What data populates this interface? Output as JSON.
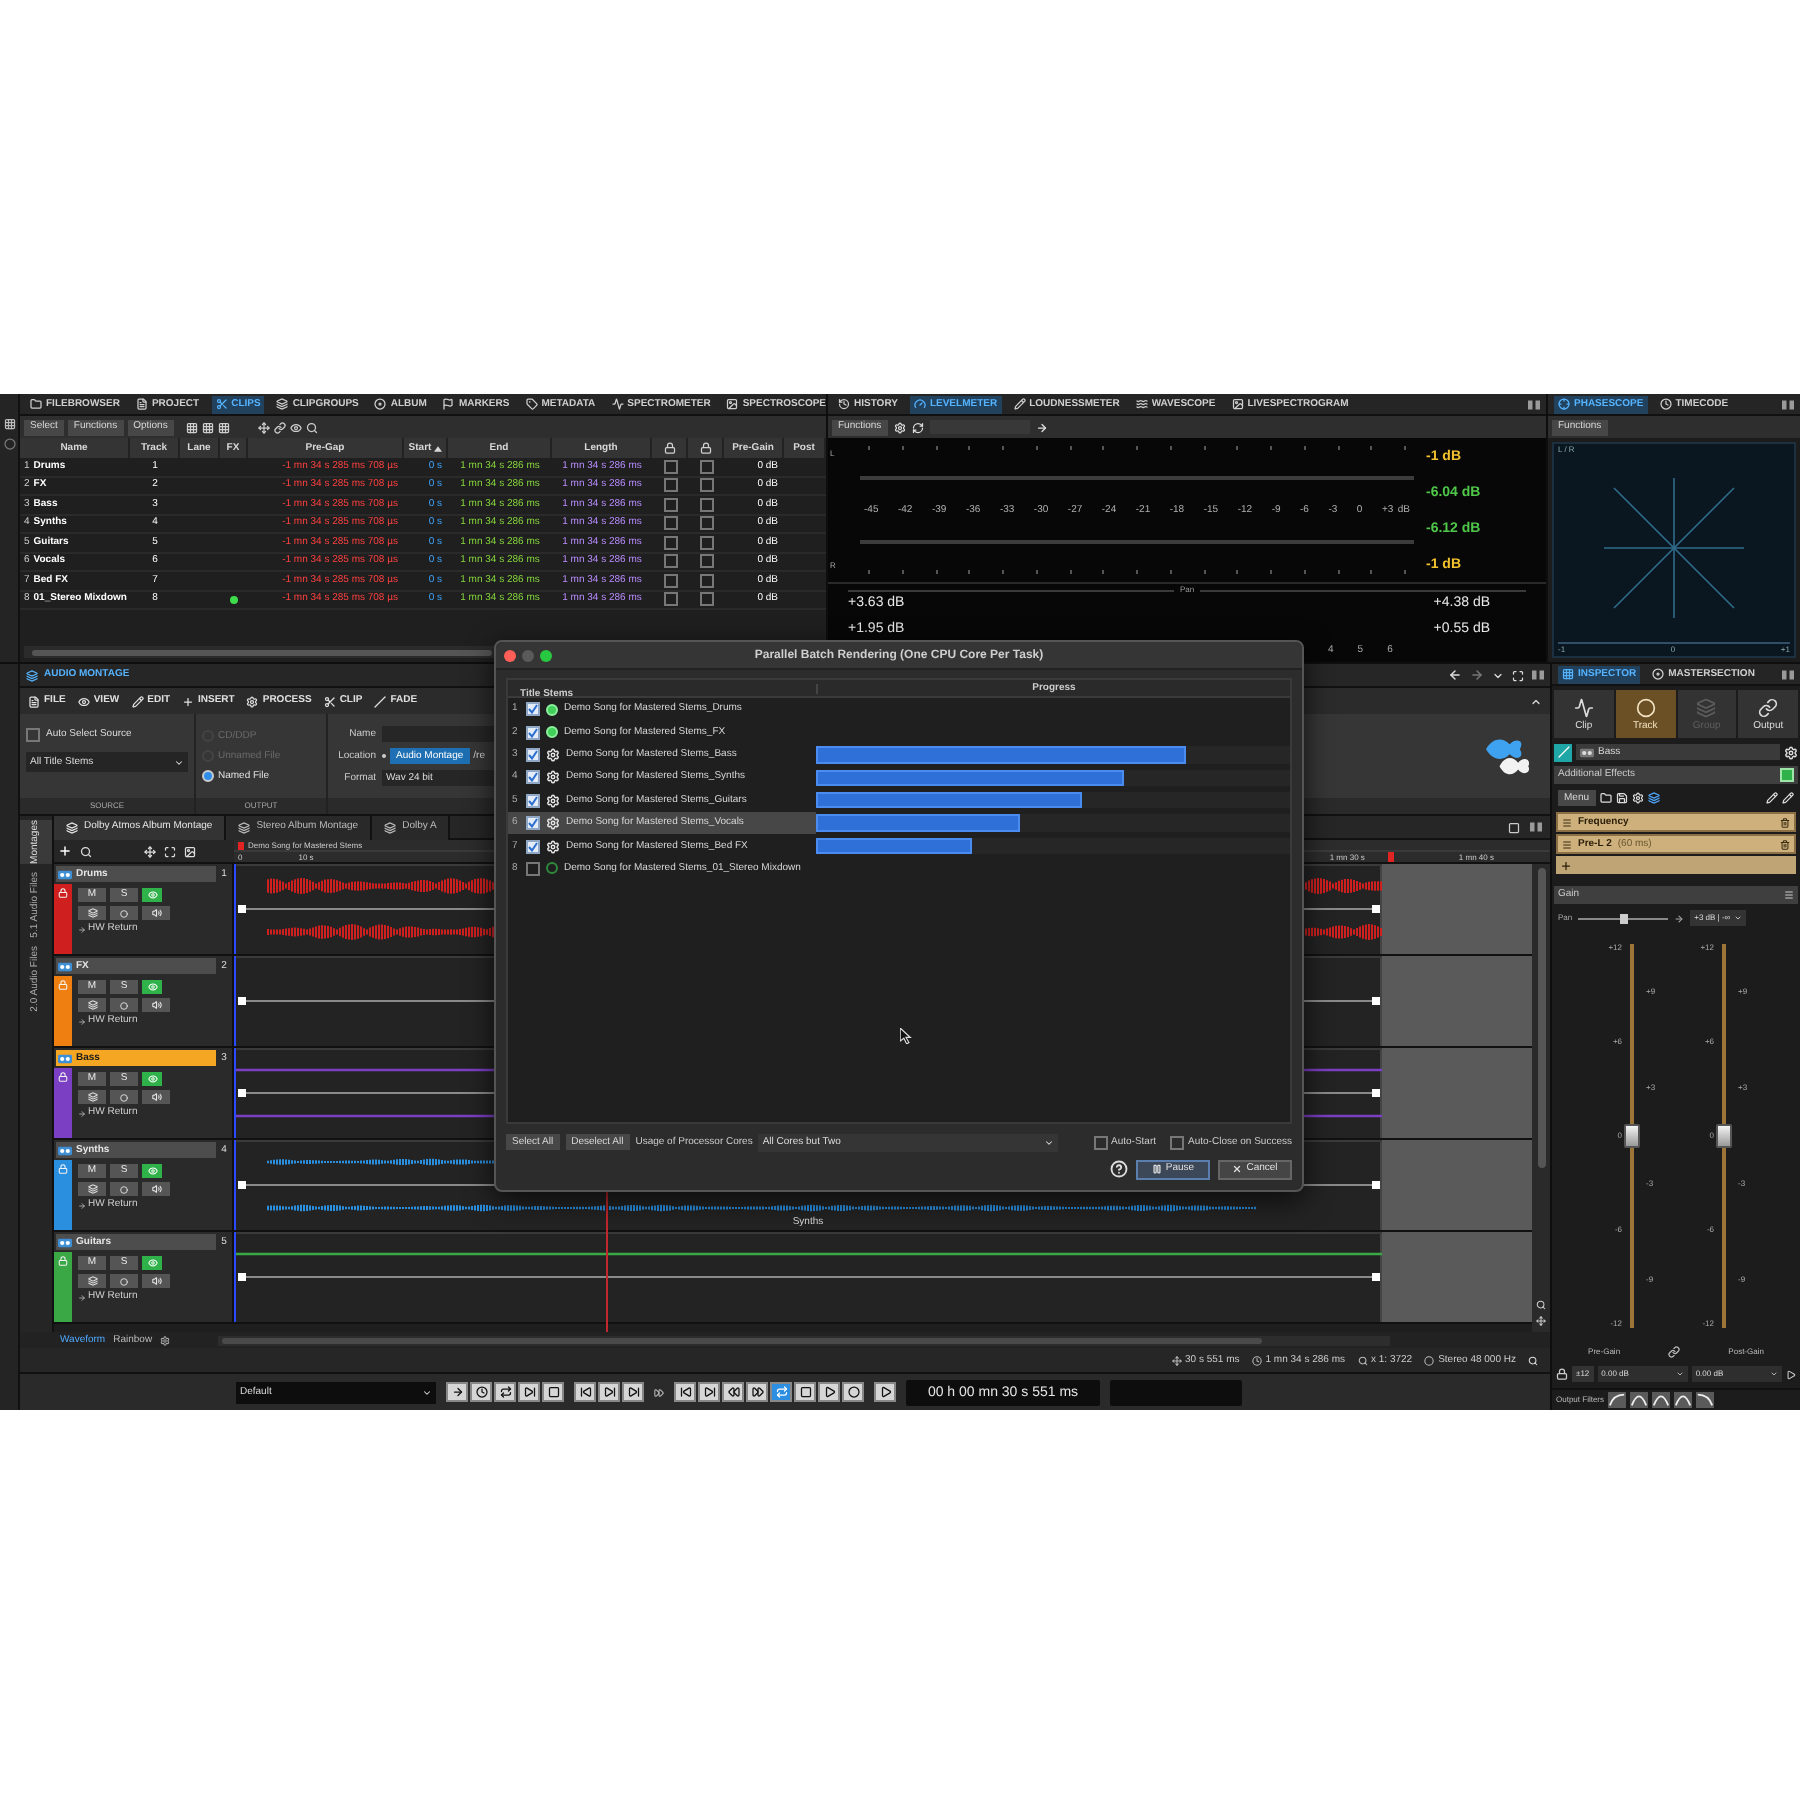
{
  "clips_panel": {
    "tabs": [
      {
        "label": "FILEBROWSER",
        "selected": false
      },
      {
        "label": "PROJECT",
        "selected": false
      },
      {
        "label": "CLIPS",
        "selected": true
      },
      {
        "label": "CLIPGROUPS",
        "selected": false
      },
      {
        "label": "ALBUM",
        "selected": false
      },
      {
        "label": "MARKERS",
        "selected": false
      },
      {
        "label": "METADATA",
        "selected": false
      },
      {
        "label": "SPECTROMETER",
        "selected": false
      },
      {
        "label": "SPECTROSCOPE",
        "selected": false
      }
    ],
    "toolbar": [
      "Select",
      "Functions",
      "Options"
    ],
    "columns": [
      {
        "kind": "text",
        "label": "Name"
      },
      {
        "kind": "text",
        "label": "Track"
      },
      {
        "kind": "text",
        "label": "Lane"
      },
      {
        "kind": "text",
        "label": "FX"
      },
      {
        "kind": "text",
        "label": "Pre-Gap"
      },
      {
        "kind": "sorted",
        "label": "Start"
      },
      {
        "kind": "text",
        "label": "End"
      },
      {
        "kind": "text",
        "label": "Length"
      },
      {
        "kind": "lock"
      },
      {
        "kind": "lock"
      },
      {
        "kind": "text",
        "label": "Pre-Gain"
      },
      {
        "kind": "text",
        "label": "Post"
      }
    ],
    "rows": [
      {
        "index": "1",
        "name": "Drums",
        "track": "1",
        "fx": false,
        "pre_gap": "-1 mn 34 s 285 ms 708 µs",
        "start": "0 s",
        "end": "1 mn 34 s 286 ms",
        "length": "1 mn 34 s 286 ms",
        "lock_a": false,
        "lock_b": false,
        "pre_gain": "0 dB"
      },
      {
        "index": "2",
        "name": "FX",
        "track": "2",
        "fx": false,
        "pre_gap": "-1 mn 34 s 285 ms 708 µs",
        "start": "0 s",
        "end": "1 mn 34 s 286 ms",
        "length": "1 mn 34 s 286 ms",
        "lock_a": false,
        "lock_b": false,
        "pre_gain": "0 dB"
      },
      {
        "index": "3",
        "name": "Bass",
        "track": "3",
        "fx": false,
        "pre_gap": "-1 mn 34 s 285 ms 708 µs",
        "start": "0 s",
        "end": "1 mn 34 s 286 ms",
        "length": "1 mn 34 s 286 ms",
        "lock_a": false,
        "lock_b": false,
        "pre_gain": "0 dB"
      },
      {
        "index": "4",
        "name": "Synths",
        "track": "4",
        "fx": false,
        "pre_gap": "-1 mn 34 s 285 ms 708 µs",
        "start": "0 s",
        "end": "1 mn 34 s 286 ms",
        "length": "1 mn 34 s 286 ms",
        "lock_a": false,
        "lock_b": false,
        "pre_gain": "0 dB"
      },
      {
        "index": "5",
        "name": "Guitars",
        "track": "5",
        "fx": false,
        "pre_gap": "-1 mn 34 s 285 ms 708 µs",
        "start": "0 s",
        "end": "1 mn 34 s 286 ms",
        "length": "1 mn 34 s 286 ms",
        "lock_a": false,
        "lock_b": false,
        "pre_gain": "0 dB"
      },
      {
        "index": "6",
        "name": "Vocals",
        "track": "6",
        "fx": false,
        "pre_gap": "-1 mn 34 s 285 ms 708 µs",
        "start": "0 s",
        "end": "1 mn 34 s 286 ms",
        "length": "1 mn 34 s 286 ms",
        "lock_a": false,
        "lock_b": false,
        "pre_gain": "0 dB"
      },
      {
        "index": "7",
        "name": "Bed FX",
        "track": "7",
        "fx": false,
        "pre_gap": "-1 mn 34 s 285 ms 708 µs",
        "start": "0 s",
        "end": "1 mn 34 s 286 ms",
        "length": "1 mn 34 s 286 ms",
        "lock_a": false,
        "lock_b": false,
        "pre_gain": "0 dB"
      },
      {
        "index": "8",
        "name": "01_Stereo Mixdown",
        "track": "8",
        "fx": true,
        "pre_gap": "-1 mn 34 s 285 ms 708 µs",
        "start": "0 s",
        "end": "1 mn 34 s 286 ms",
        "length": "1 mn 34 s 286 ms",
        "lock_a": false,
        "lock_b": false,
        "pre_gain": "0 dB"
      }
    ]
  },
  "levelmeter": {
    "tabs": [
      {
        "label": "HISTORY",
        "selected": false
      },
      {
        "label": "LEVELMETER",
        "selected": true
      },
      {
        "label": "LOUDNESSMETER",
        "selected": false
      },
      {
        "label": "WAVESCOPE",
        "selected": false
      },
      {
        "label": "LIVESPECTROGRAM",
        "selected": false
      }
    ],
    "toolbar": "Functions",
    "channels": [
      "L",
      "R"
    ],
    "scale": [
      "-45",
      "-42",
      "-39",
      "-36",
      "-33",
      "-30",
      "-27",
      "-24",
      "-21",
      "-18",
      "-15",
      "-12",
      "-9",
      "-6",
      "-3",
      "0",
      "+3"
    ],
    "unit": "dB",
    "readouts": [
      {
        "kind": "peak",
        "text": "-1 dB"
      },
      {
        "kind": "rms",
        "text": "-6.04 dB"
      },
      {
        "kind": "rms",
        "text": "-6.12 dB"
      },
      {
        "kind": "peak",
        "text": "-1 dB"
      }
    ],
    "pan_label": "Pan",
    "left_values": [
      "+3.63 dB",
      "+1.95 dB"
    ],
    "right_values": [
      "+4.38 dB",
      "+0.55 dB"
    ],
    "bottom_labels": [
      "4",
      "5",
      "6"
    ]
  },
  "phasescope": {
    "tabs": [
      {
        "label": "PHASESCOPE",
        "selected": true
      },
      {
        "label": "TIMECODE",
        "selected": false
      }
    ],
    "toolbar": "Functions",
    "corner_label": "L / R",
    "axis": [
      "-1",
      "0",
      "+1"
    ]
  },
  "montage": {
    "title": "AUDIO MONTAGE",
    "menu": [
      "FILE",
      "VIEW",
      "EDIT",
      "INSERT",
      "PROCESS",
      "CLIP",
      "FADE"
    ],
    "source": {
      "auto_select": {
        "label": "Auto Select Source",
        "checked": false
      },
      "selection": "All Title Stems",
      "caption": "SOURCE"
    },
    "output": {
      "options": [
        {
          "label": "CD/DDP",
          "selected": false,
          "disabled": true
        },
        {
          "label": "Unnamed File",
          "selected": false,
          "disabled": true
        },
        {
          "label": "Named File",
          "selected": true,
          "disabled": false
        }
      ],
      "caption": "OUTPUT"
    },
    "file": {
      "name_label": "Name",
      "location_label": "Location",
      "location": "Audio Montage",
      "location_path": "/re",
      "format_label": "Format",
      "format": "Wav 24 bit"
    },
    "tabs": [
      {
        "label": "Dolby Atmos Album Montage",
        "selected": true
      },
      {
        "label": "Stereo Album Montage",
        "selected": false
      },
      {
        "label": "Dolby A",
        "selected": false
      }
    ],
    "side_tabs": [
      {
        "label": "Montages",
        "selected": true
      },
      {
        "label": "5.1 Audio Files",
        "selected": false
      },
      {
        "label": "2.0 Audio Files",
        "selected": false
      }
    ],
    "marker_title": "Demo Song for Mastered Stems",
    "ruler_start": [
      "0",
      "10 s"
    ],
    "ruler_end": [
      "1 mn 30 s",
      "1 mn 40 s"
    ],
    "tracks": [
      {
        "name": "Drums",
        "number": "1",
        "color": "#d01f1f",
        "selected": false,
        "kind": "dense",
        "mute": "M",
        "solo": "S",
        "route": "HW Return"
      },
      {
        "name": "FX",
        "number": "2",
        "color": "#f07f12",
        "selected": false,
        "kind": "empty",
        "mute": "M",
        "solo": "S",
        "route": "HW Return"
      },
      {
        "name": "Bass",
        "number": "3",
        "color": "#7b3fc4",
        "selected": true,
        "kind": "flat",
        "mute": "M",
        "solo": "S",
        "route": "HW Return"
      },
      {
        "name": "Synths",
        "number": "4",
        "color": "#2b8fe0",
        "selected": false,
        "kind": "sparse",
        "mute": "M",
        "solo": "S",
        "route": "HW Return",
        "clip_label": "Synths"
      },
      {
        "name": "Guitars",
        "number": "5",
        "color": "#3aa845",
        "selected": false,
        "kind": "line",
        "mute": "M",
        "solo": "S",
        "route": "HW Return"
      }
    ],
    "view_tabs": [
      {
        "label": "Waveform",
        "selected": true
      },
      {
        "label": "Rainbow",
        "selected": false
      }
    ],
    "status": [
      "30 s 551 ms",
      "1 mn 34 s 286 ms",
      "x 1: 3722",
      "Stereo 48 000 Hz"
    ]
  },
  "transport": {
    "preset": "Default",
    "loop": {
      "on": true
    },
    "time": "00 h 00 mn 30 s 551 ms"
  },
  "inspector": {
    "tabs": [
      {
        "label": "INSPECTOR",
        "selected": true
      },
      {
        "label": "MASTERSECTION",
        "selected": false
      }
    ],
    "modes": [
      {
        "label": "Clip",
        "selected": false,
        "disabled": false
      },
      {
        "label": "Track",
        "selected": true,
        "disabled": false
      },
      {
        "label": "Group",
        "selected": false,
        "disabled": true
      },
      {
        "label": "Output",
        "selected": false,
        "disabled": false
      }
    ],
    "track": "Bass",
    "effects_title": "Additional Effects",
    "menu": "Menu",
    "plugins": [
      {
        "name": "Frequency"
      },
      {
        "name": "Pre-L 2",
        "latency": "(60 ms)"
      }
    ],
    "gain_title": "Gain",
    "pan": {
      "label": "Pan",
      "level": 0.5,
      "value": "+3 dB | -∞"
    },
    "faders": [
      {
        "label": "Pre-Gain",
        "level": 0.5,
        "value": "0.00 dB",
        "scale_outer": [
          "+12",
          "+6",
          "0",
          "-6",
          "-12"
        ],
        "scale_inner": [
          "+9",
          "+3",
          "-3",
          "-9"
        ]
      },
      {
        "label": "Post-Gain",
        "level": 0.5,
        "value": "0.00 dB",
        "scale_outer": [
          "+12",
          "+6",
          "0",
          "-6",
          "-12"
        ],
        "scale_inner": [
          "+9",
          "+3",
          "-3",
          "-9"
        ]
      }
    ],
    "range": "±12",
    "output_filters": "Output Filters"
  },
  "dialog": {
    "title": "Parallel Batch Rendering (One CPU Core Per Task)",
    "columns": [
      "Title Stems",
      "Progress"
    ],
    "rows": [
      {
        "index": "1",
        "checked": true,
        "kind": "done",
        "name": "Demo Song for Mastered Stems_Drums",
        "selected": false
      },
      {
        "index": "2",
        "checked": true,
        "kind": "done",
        "name": "Demo Song for Mastered Stems_FX",
        "selected": false
      },
      {
        "index": "3",
        "checked": true,
        "kind": "running",
        "name": "Demo Song for Mastered Stems_Bass",
        "selected": false,
        "level": 0.78
      },
      {
        "index": "4",
        "checked": true,
        "kind": "running",
        "name": "Demo Song for Mastered Stems_Synths",
        "selected": false,
        "level": 0.65
      },
      {
        "index": "5",
        "checked": true,
        "kind": "running",
        "name": "Demo Song for Mastered Stems_Guitars",
        "selected": false,
        "level": 0.56
      },
      {
        "index": "6",
        "checked": true,
        "kind": "running",
        "name": "Demo Song for Mastered Stems_Vocals",
        "selected": true,
        "level": 0.43
      },
      {
        "index": "7",
        "checked": true,
        "kind": "running",
        "name": "Demo Song for Mastered Stems_Bed FX",
        "selected": false,
        "level": 0.33
      },
      {
        "index": "8",
        "checked": false,
        "kind": "pending",
        "name": "Demo Song for Mastered Stems_01_Stereo Mixdown",
        "selected": false
      }
    ],
    "select_all": "Select All",
    "deselect_all": "Deselect All",
    "cores_label": "Usage of Processor Cores",
    "cores": "All Cores but Two",
    "auto_start": {
      "label": "Auto-Start",
      "checked": false
    },
    "auto_close": {
      "label": "Auto-Close on Success",
      "checked": false
    },
    "pause": "Pause",
    "cancel": "Cancel"
  }
}
